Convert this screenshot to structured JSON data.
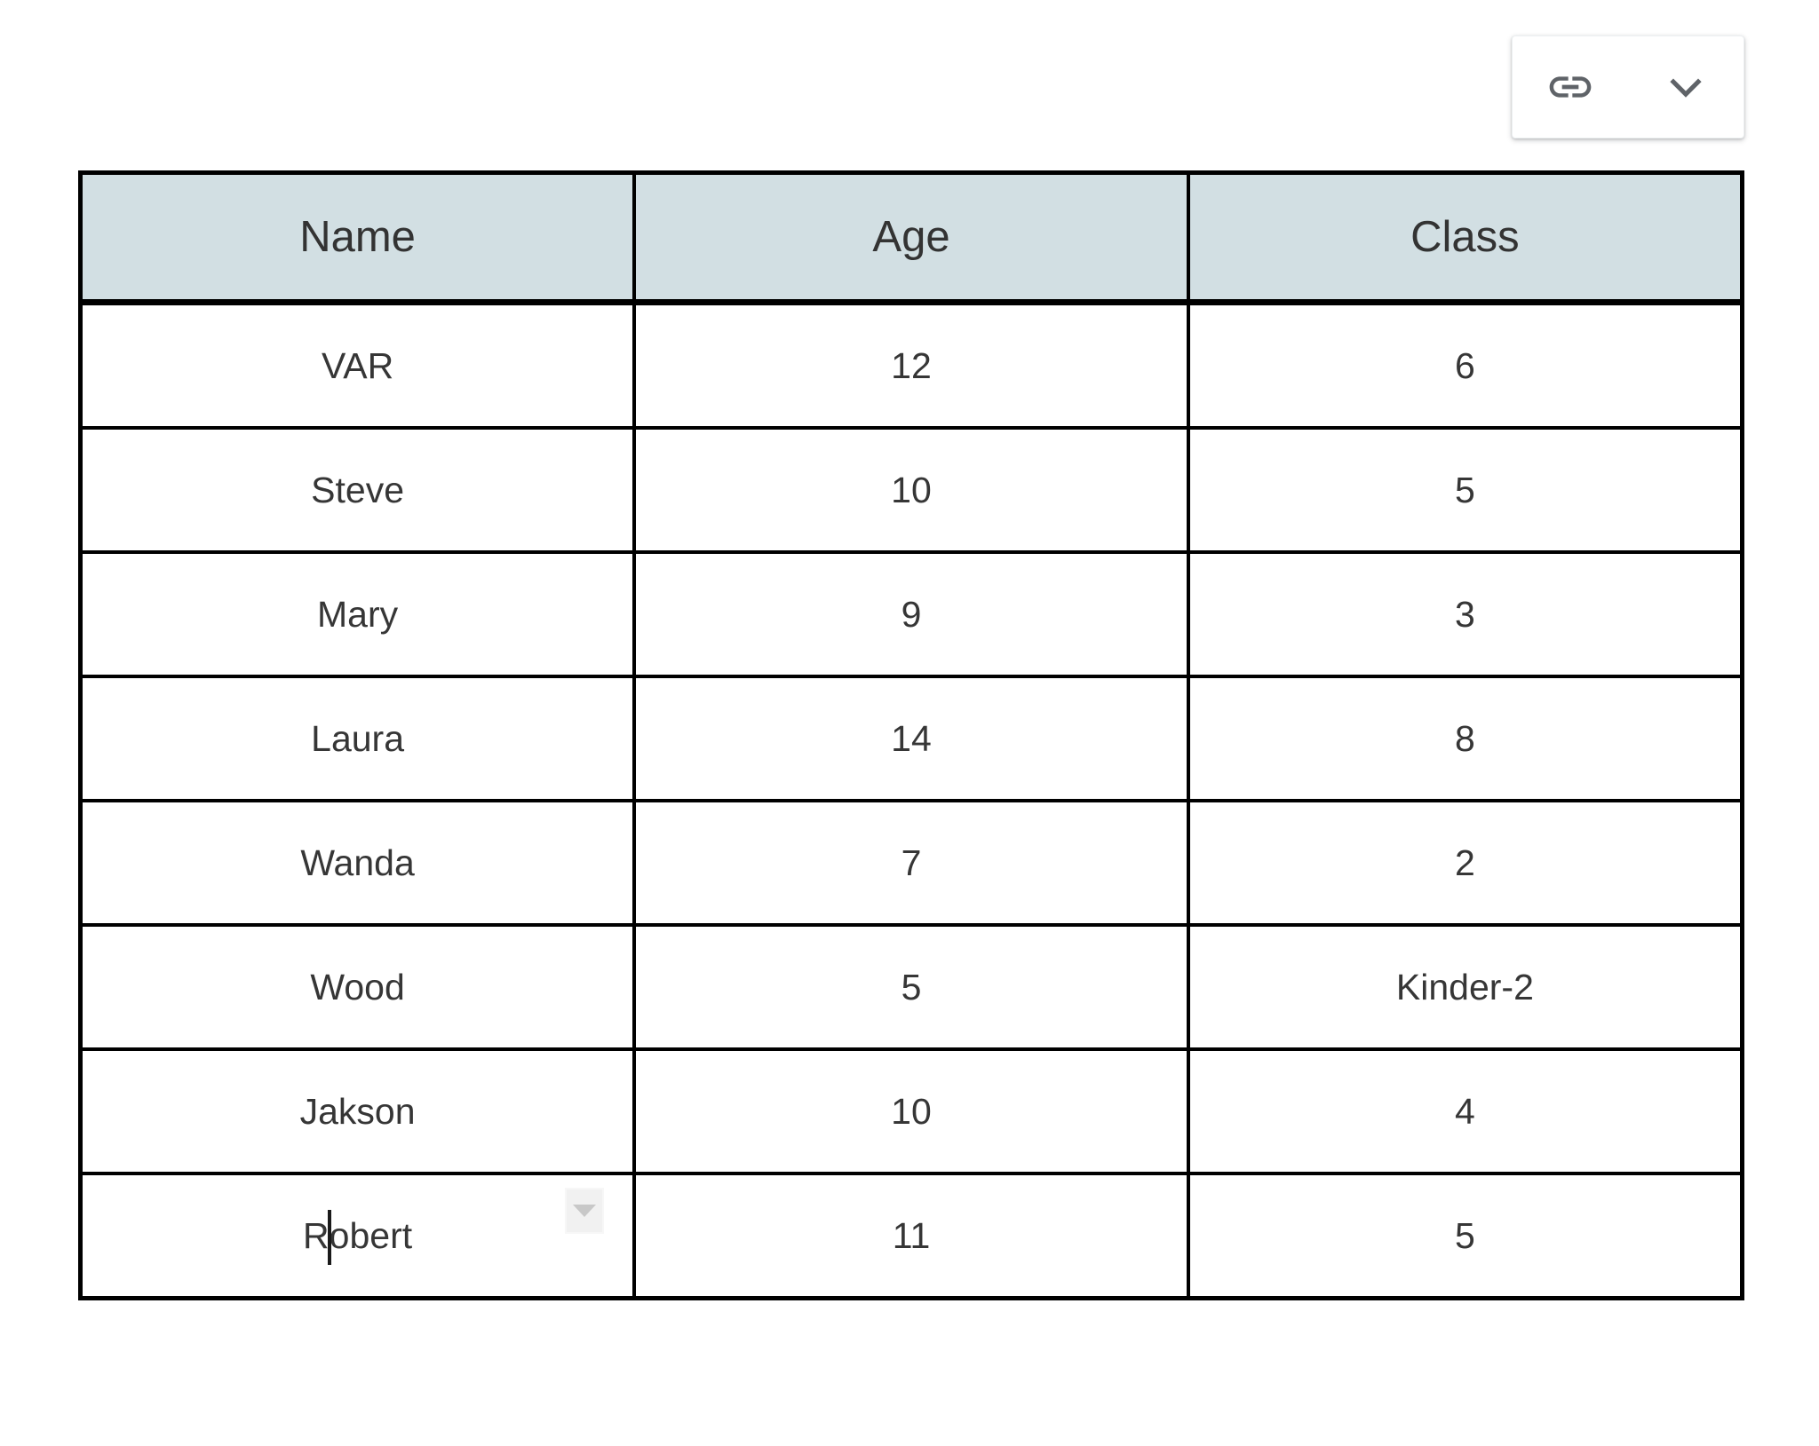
{
  "toolbar": {
    "link_button": {
      "icon": "link-icon",
      "label": "Insert link"
    },
    "menu_button": {
      "icon": "chevron-down-icon",
      "label": "More options"
    }
  },
  "table": {
    "columns": [
      "Name",
      "Age",
      "Class"
    ],
    "rows": [
      {
        "name": "VAR",
        "age": "12",
        "class": "6"
      },
      {
        "name": "Steve",
        "age": "10",
        "class": "5"
      },
      {
        "name": "Mary",
        "age": "9",
        "class": "3"
      },
      {
        "name": "Laura",
        "age": "14",
        "class": "8"
      },
      {
        "name": "Wanda",
        "age": "7",
        "class": "2"
      },
      {
        "name": "Wood",
        "age": "5",
        "class": "Kinder-2"
      },
      {
        "name": "Jakson",
        "age": "10",
        "class": "4"
      },
      {
        "name": "Robert",
        "age": "11",
        "class": "5"
      }
    ],
    "editing_cell": {
      "row_index": 7,
      "column": "Name",
      "text_before_caret": "R",
      "text_after_caret": "obert",
      "dropdown_icon": "dropdown-triangle-icon"
    }
  },
  "colors": {
    "header_background": "#d2dfe3",
    "border": "#000000",
    "cell_text": "#363636",
    "header_text": "#333333",
    "page_background": "#ffffff",
    "icon_gray": "#5f6368"
  }
}
